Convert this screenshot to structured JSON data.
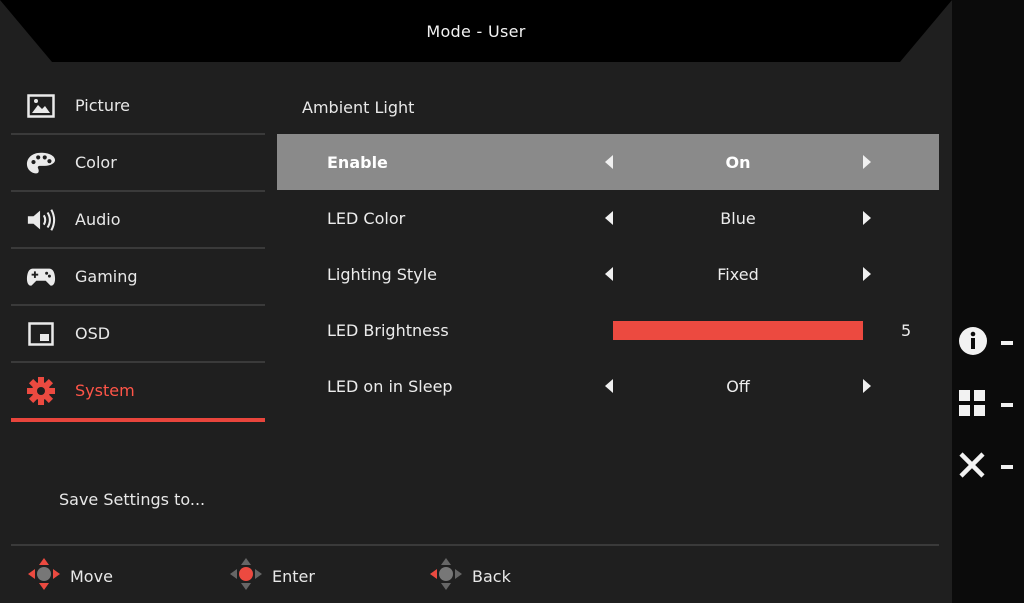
{
  "header": {
    "title": "Mode - User"
  },
  "sidebar": {
    "items": [
      {
        "label": "Picture",
        "icon": "picture-icon"
      },
      {
        "label": "Color",
        "icon": "palette-icon"
      },
      {
        "label": "Audio",
        "icon": "speaker-icon"
      },
      {
        "label": "Gaming",
        "icon": "gamepad-icon"
      },
      {
        "label": "OSD",
        "icon": "osd-window-icon"
      },
      {
        "label": "System",
        "icon": "gear-icon",
        "active": true
      }
    ],
    "save_settings": "Save Settings to..."
  },
  "main": {
    "section_title": "Ambient Light",
    "settings": [
      {
        "label": "Enable",
        "value": "On",
        "selected": true
      },
      {
        "label": "LED Color",
        "value": "Blue"
      },
      {
        "label": "Lighting Style",
        "value": "Fixed"
      },
      {
        "label": "LED Brightness",
        "value": "5",
        "level": 1.0
      },
      {
        "label": "LED on in Sleep",
        "value": "Off"
      }
    ]
  },
  "footer": {
    "move": "Move",
    "enter": "Enter",
    "back": "Back"
  },
  "side_keys": [
    {
      "icon": "info-icon",
      "label": "-"
    },
    {
      "icon": "grid-icon",
      "label": "-"
    },
    {
      "icon": "close-icon",
      "label": "-"
    }
  ],
  "colors": {
    "accent": "#e8453c",
    "background": "#1f1f1f",
    "selected_row": "#8a8a8a"
  }
}
